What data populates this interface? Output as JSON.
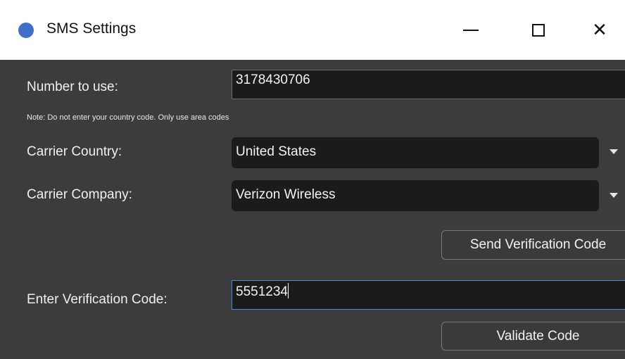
{
  "window": {
    "title": "SMS Settings",
    "icon": "app-circle-icon",
    "accent_color": "#3f6fc9"
  },
  "titlebar_controls": {
    "minimize_icon": "minimize-icon",
    "maximize_icon": "maximize-icon",
    "close_icon": "close-icon",
    "close_glyph": "✕"
  },
  "form": {
    "number_label": "Number to use:",
    "number_value": "3178430706",
    "note": "Note: Do not enter your country code. Only use area codes",
    "country_label": "Carrier Country:",
    "country_value": "United States",
    "company_label": "Carrier Company:",
    "company_value": "Verizon Wireless",
    "send_button": "Send Verification Code",
    "verify_label": "Enter Verification Code:",
    "verify_value": "5551234",
    "validate_button": "Validate Code"
  },
  "colors": {
    "background": "#3c3c3c",
    "input_background": "#1b1b1b",
    "focus_border": "#3d8ee0"
  }
}
